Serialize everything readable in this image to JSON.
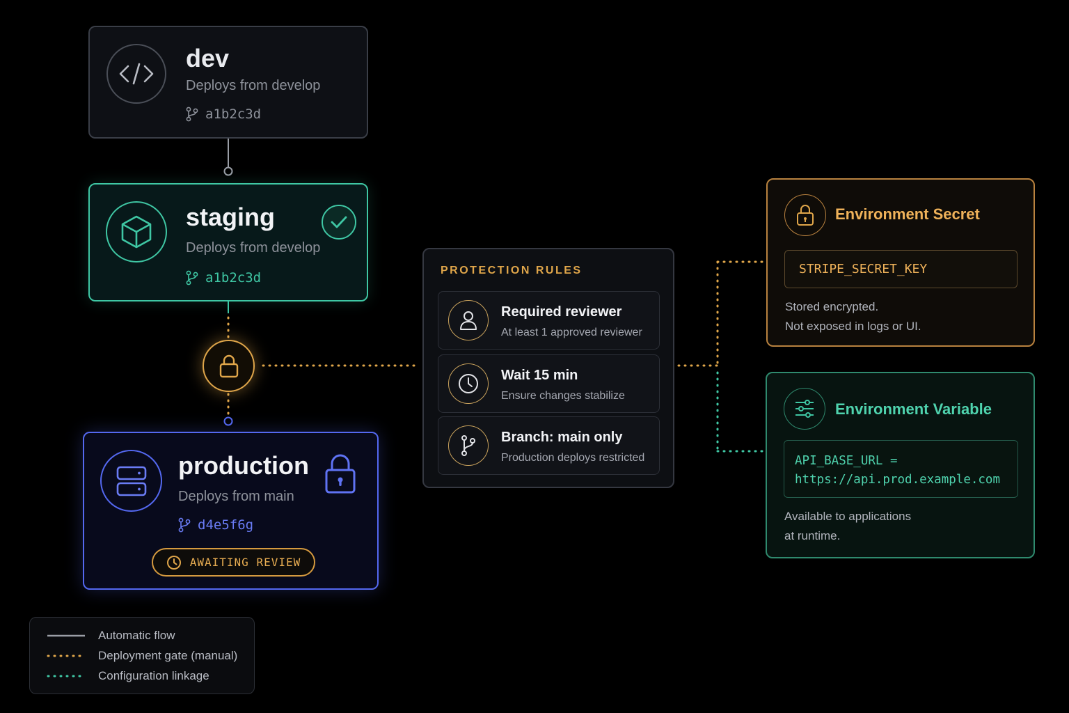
{
  "environments": {
    "dev": {
      "name": "dev",
      "source": "Deploys from develop",
      "commit": "a1b2c3d"
    },
    "staging": {
      "name": "staging",
      "source": "Deploys from develop",
      "commit": "a1b2c3d"
    },
    "production": {
      "name": "production",
      "source": "Deploys from main",
      "commit": "d4e5f6g",
      "status": "AWAITING REVIEW"
    }
  },
  "protection_rules": {
    "heading": "PROTECTION RULES",
    "rules": [
      {
        "title": "Required reviewer",
        "detail": "At least 1 approved reviewer",
        "icon": "user-icon"
      },
      {
        "title": "Wait 15 min",
        "detail": "Ensure changes stabilize",
        "icon": "clock-icon"
      },
      {
        "title": "Branch: main only",
        "detail": "Production deploys restricted",
        "icon": "branch-icon"
      }
    ]
  },
  "secret": {
    "title": "Environment Secret",
    "key": "STRIPE_SECRET_KEY",
    "note_line1": "Stored encrypted.",
    "note_line2": "Not exposed in logs or UI."
  },
  "variable": {
    "title": "Environment Variable",
    "value_line1": "API_BASE_URL =",
    "value_line2": "https://api.prod.example.com",
    "note_line1": "Available to applications",
    "note_line2": "at runtime."
  },
  "legend": {
    "items": [
      {
        "label": "Automatic flow",
        "style": "solid",
        "color": "#9a9ea6"
      },
      {
        "label": "Deployment gate (manual)",
        "style": "dotted",
        "color": "#e0a64a"
      },
      {
        "label": "Configuration linkage",
        "style": "dotted",
        "color": "#3fc7a4"
      }
    ]
  },
  "colors": {
    "staging": "#3fc7a4",
    "production": "#5468f0",
    "gate": "#e0a64a",
    "config": "#3fc7a4",
    "neutral": "#9a9ea6"
  }
}
